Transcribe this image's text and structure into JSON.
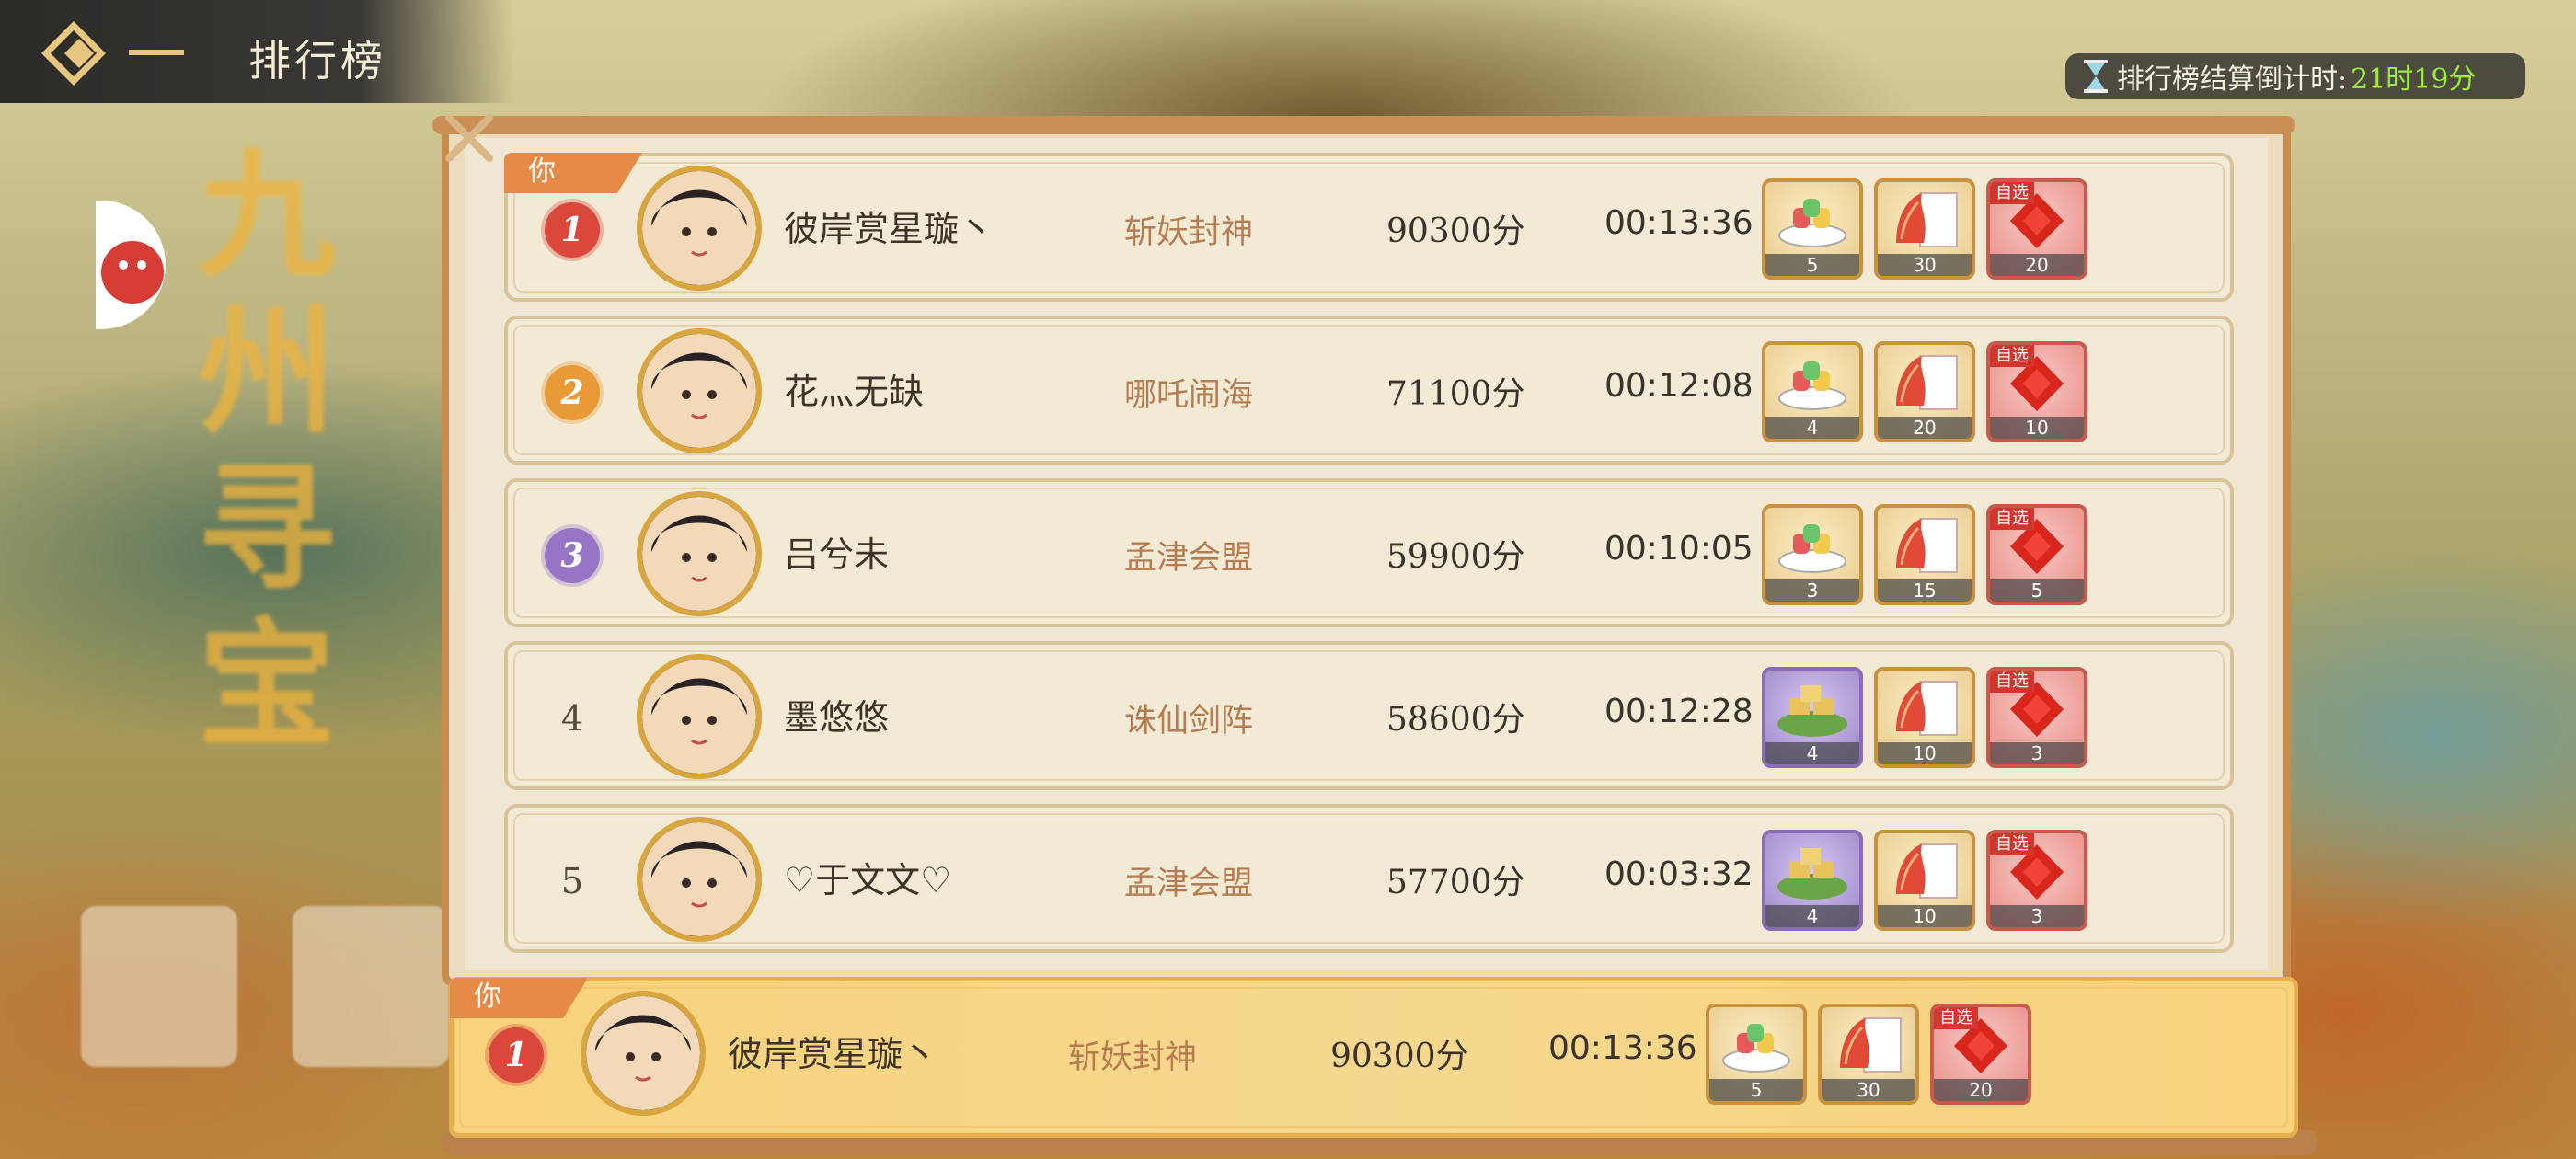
{
  "header": {
    "title": "排行榜"
  },
  "timer": {
    "label": "排行榜结算倒计时:",
    "value": "21时19分"
  },
  "side_banner": {
    "text": "九州寻宝"
  },
  "you_tag": "你",
  "rows": [
    {
      "rank": "1",
      "name": "彼岸赏星璇丶",
      "guild": "斩妖封神",
      "score": "90300分",
      "time": "00:13:36",
      "rewards": [
        {
          "icon": "dessert-plate-icon",
          "count": "5"
        },
        {
          "icon": "phoenix-card-icon",
          "count": "30"
        },
        {
          "icon": "red-gem-icon",
          "count": "20",
          "tag": "自选"
        }
      ]
    },
    {
      "rank": "2",
      "name": "花灬无缺",
      "guild": "哪吒闹海",
      "score": "71100分",
      "time": "00:12:08",
      "rewards": [
        {
          "icon": "dessert-plate-icon",
          "count": "4"
        },
        {
          "icon": "phoenix-card-icon",
          "count": "20"
        },
        {
          "icon": "red-gem-icon",
          "count": "10",
          "tag": "自选"
        }
      ]
    },
    {
      "rank": "3",
      "name": "吕兮未",
      "guild": "孟津会盟",
      "score": "59900分",
      "time": "00:10:05",
      "rewards": [
        {
          "icon": "dessert-plate-icon",
          "count": "3"
        },
        {
          "icon": "phoenix-card-icon",
          "count": "15"
        },
        {
          "icon": "red-gem-icon",
          "count": "5",
          "tag": "自选"
        }
      ]
    },
    {
      "rank": "4",
      "name": "墨悠悠",
      "guild": "诛仙剑阵",
      "score": "58600分",
      "time": "00:12:28",
      "rewards": [
        {
          "icon": "cake-leaf-icon",
          "count": "4"
        },
        {
          "icon": "phoenix-card-icon",
          "count": "10"
        },
        {
          "icon": "red-gem-icon",
          "count": "3",
          "tag": "自选"
        }
      ]
    },
    {
      "rank": "5",
      "name": "♡于文文♡",
      "guild": "孟津会盟",
      "score": "57700分",
      "time": "00:03:32",
      "rewards": [
        {
          "icon": "cake-leaf-icon",
          "count": "4"
        },
        {
          "icon": "phoenix-card-icon",
          "count": "10"
        },
        {
          "icon": "red-gem-icon",
          "count": "3",
          "tag": "自选"
        }
      ]
    }
  ],
  "my_row": {
    "rank": "1",
    "name": "彼岸赏星璇丶",
    "guild": "斩妖封神",
    "score": "90300分",
    "time": "00:13:36",
    "rewards": [
      {
        "icon": "dessert-plate-icon",
        "count": "5"
      },
      {
        "icon": "phoenix-card-icon",
        "count": "30"
      },
      {
        "icon": "red-gem-icon",
        "count": "20",
        "tag": "自选"
      }
    ]
  },
  "colors": {
    "rank1": "#d9483b",
    "rank2": "#e89a37",
    "rank3": "#9774c6",
    "highlight": "#f8d27c",
    "timer_value": "#9bec3c"
  }
}
